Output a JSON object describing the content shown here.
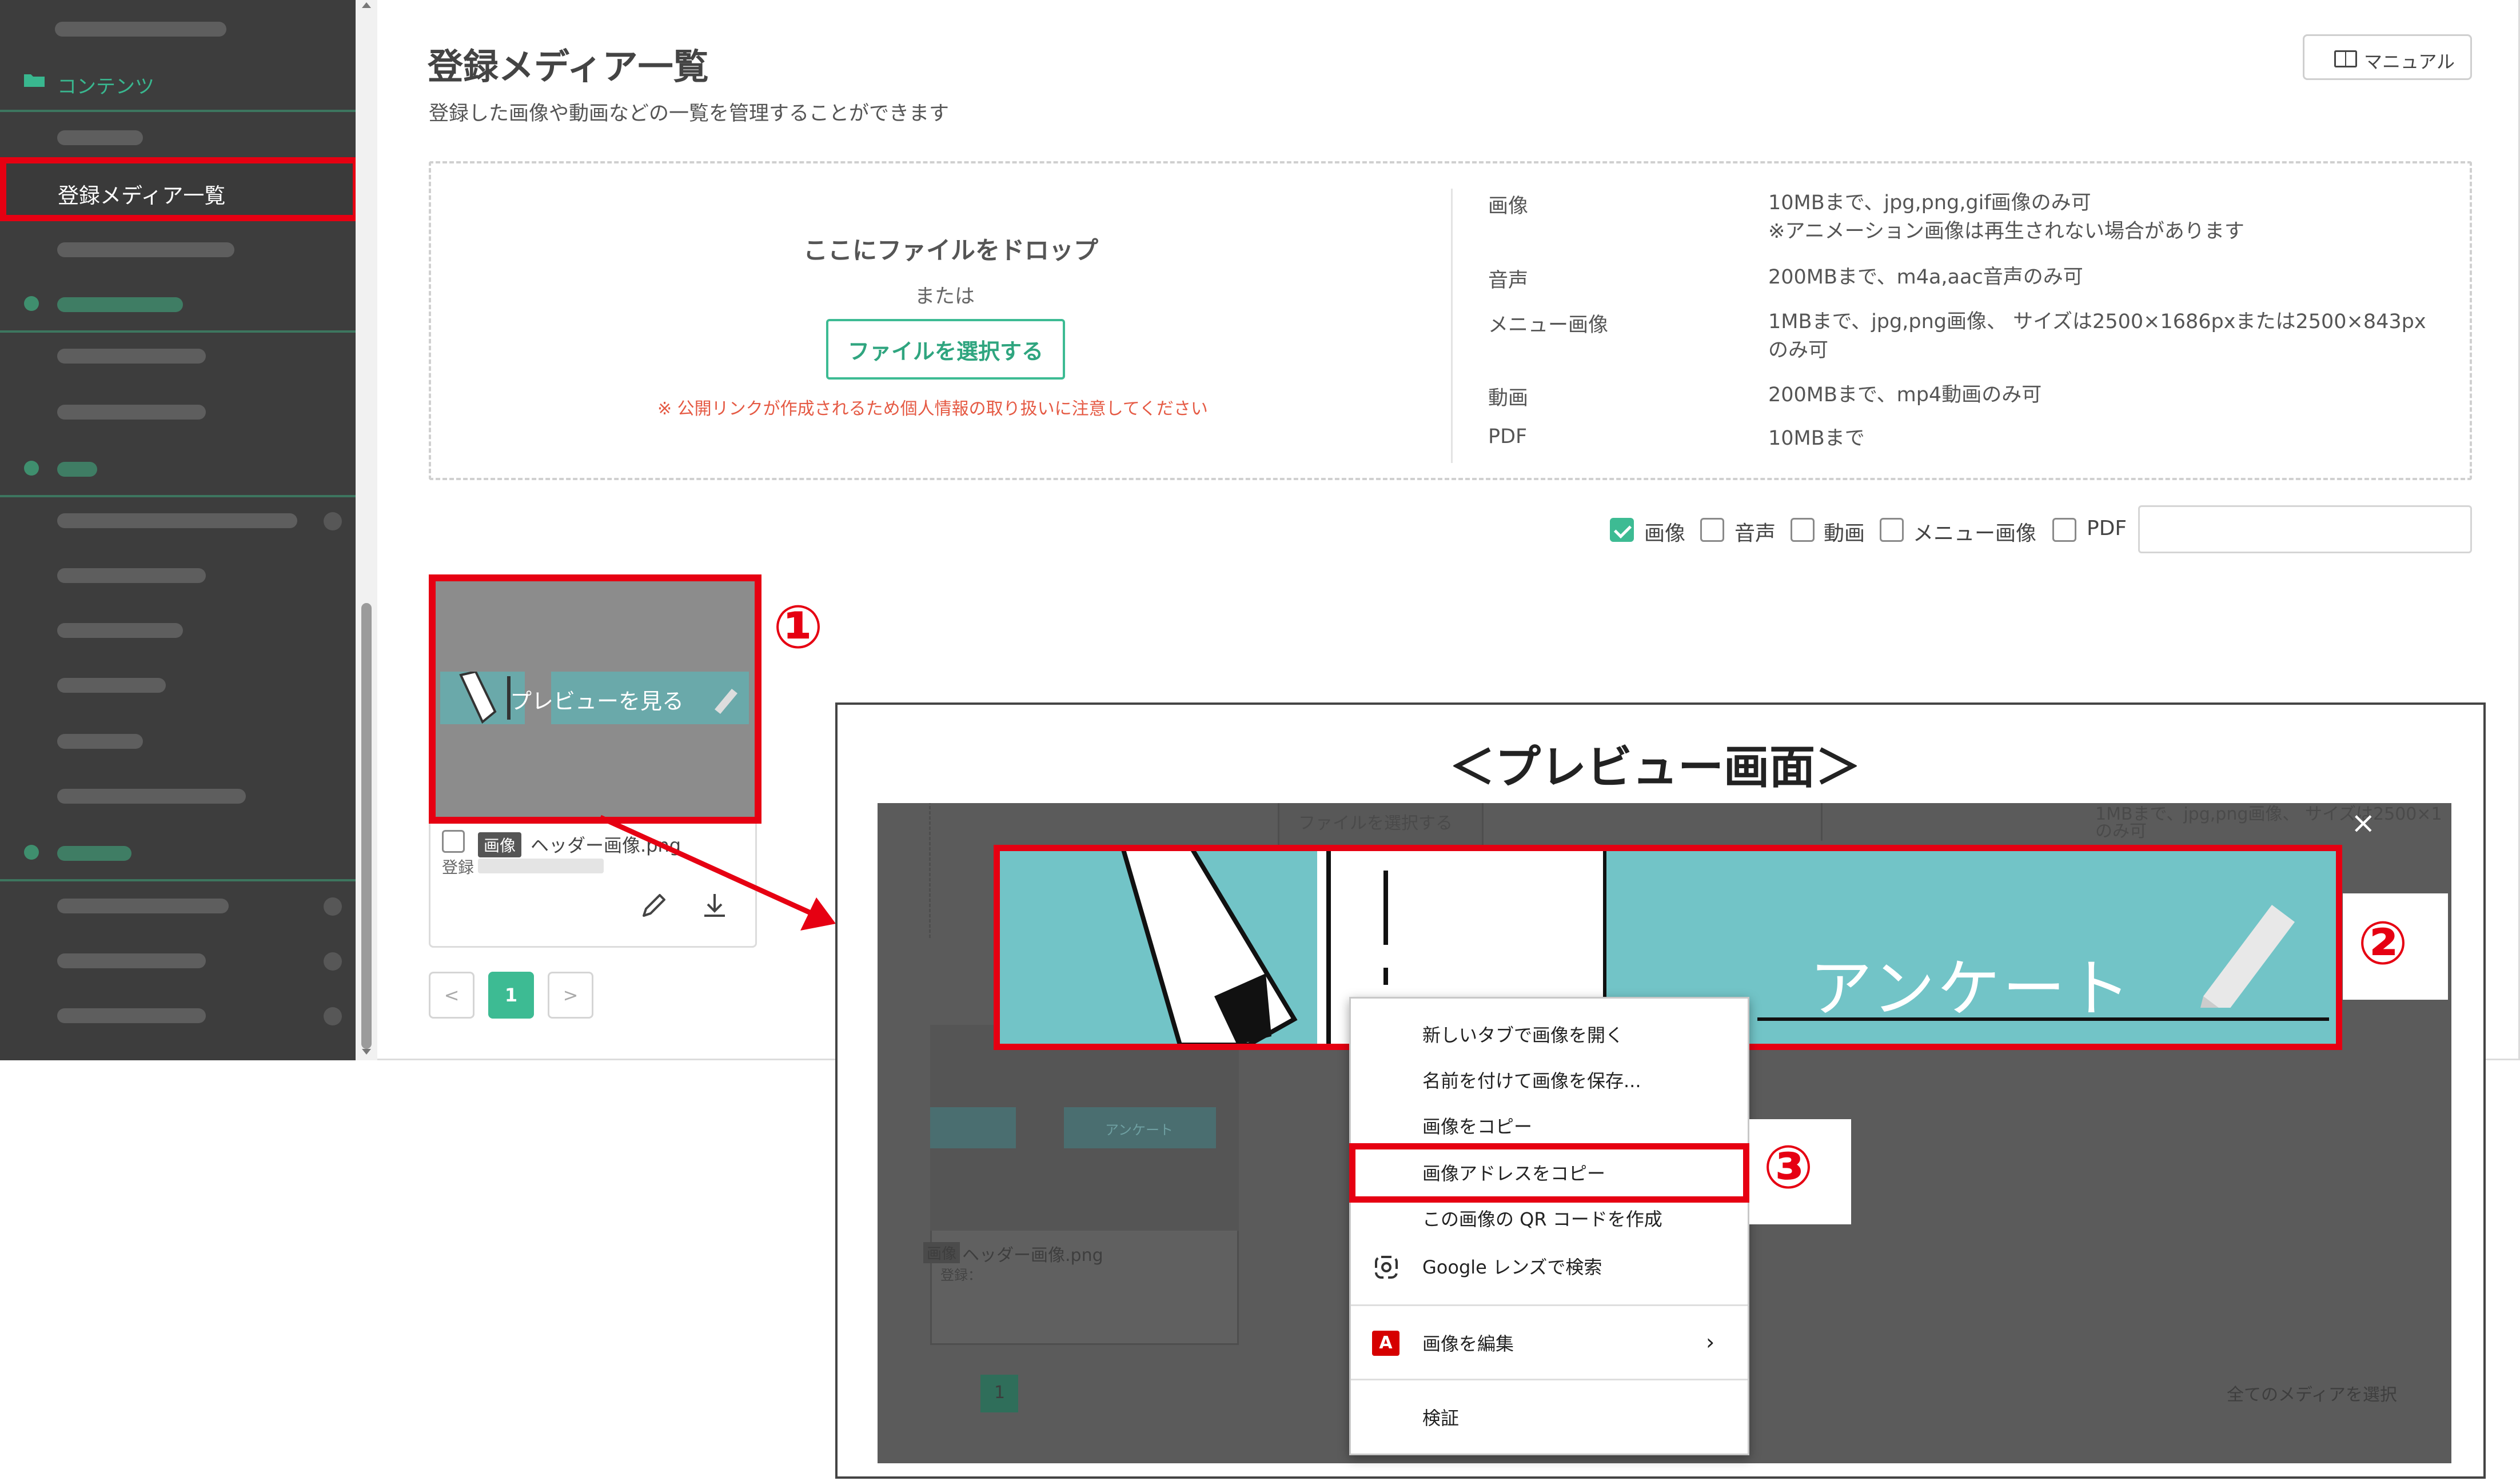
{
  "sidebar": {
    "section_label": "コンテンツ",
    "active_item": "登録メディア一覧"
  },
  "header": {
    "title": "登録メディア一覧",
    "subtitle": "登録した画像や動画などの一覧を管理することができます",
    "manual_button": "マニュアル"
  },
  "upload": {
    "drop_title": "ここにファイルをドロップ",
    "or": "または",
    "select_button": "ファイルを選択する",
    "warning": "※ 公開リンクが作成されるため個人情報の取り扱いに注意してください",
    "specs": [
      {
        "label": "画像",
        "value_line1": "10MBまで、jpg,png,gif画像のみ可",
        "value_line2": "※アニメーション画像は再生されない場合があります"
      },
      {
        "label": "音声",
        "value_line1": "200MBまで、m4a,aac音声のみ可",
        "value_line2": ""
      },
      {
        "label": "メニュー画像",
        "value_line1": "1MBまで、jpg,png画像、 サイズは2500×1686pxまたは2500×843px",
        "value_line2": "のみ可"
      },
      {
        "label": "動画",
        "value_line1": "200MBまで、mp4動画のみ可",
        "value_line2": ""
      },
      {
        "label": "PDF",
        "value_line1": "10MBまで",
        "value_line2": ""
      }
    ]
  },
  "filters": {
    "items": [
      {
        "label": "画像",
        "checked": true
      },
      {
        "label": "音声",
        "checked": false
      },
      {
        "label": "動画",
        "checked": false
      },
      {
        "label": "メニュー画像",
        "checked": false
      },
      {
        "label": "PDF",
        "checked": false
      }
    ]
  },
  "card": {
    "preview_label": "プレビューを見る",
    "badge": "画像",
    "file_name": "ヘッダー画像.png",
    "registered_prefix": "登録"
  },
  "pagination": {
    "prev": "<",
    "current": "1",
    "next": ">"
  },
  "annotations": {
    "step1": "①",
    "step2": "②",
    "step3": "③"
  },
  "preview": {
    "title": "＜プレビュー画面＞",
    "banner_text": "アンケート",
    "close": "×",
    "ghost_select_button": "ファイルを選択する",
    "ghost_card_badge": "画像",
    "ghost_card_name": "ヘッダー画像.png",
    "ghost_card_reg": "登録：",
    "ghost_page": "1",
    "ghost_select_all": "全てのメディアを選択",
    "ghost_banner_text": "アンケート",
    "ghost_spec_line": "1MBまで、jpg,png画像、 サイズは2500×1",
    "ghost_spec_line2": "のみ可"
  },
  "context_menu": {
    "items": [
      "新しいタブで画像を開く",
      "名前を付けて画像を保存...",
      "画像をコピー",
      "画像アドレスをコピー",
      "この画像の QR コードを作成",
      "Google レンズで検索",
      "画像を編集",
      "検証"
    ]
  },
  "colors": {
    "accent_green": "#3dbb93",
    "highlight_red": "#e60012",
    "sidebar_bg": "#3d3d3d",
    "banner_teal": "#72c4c7"
  }
}
